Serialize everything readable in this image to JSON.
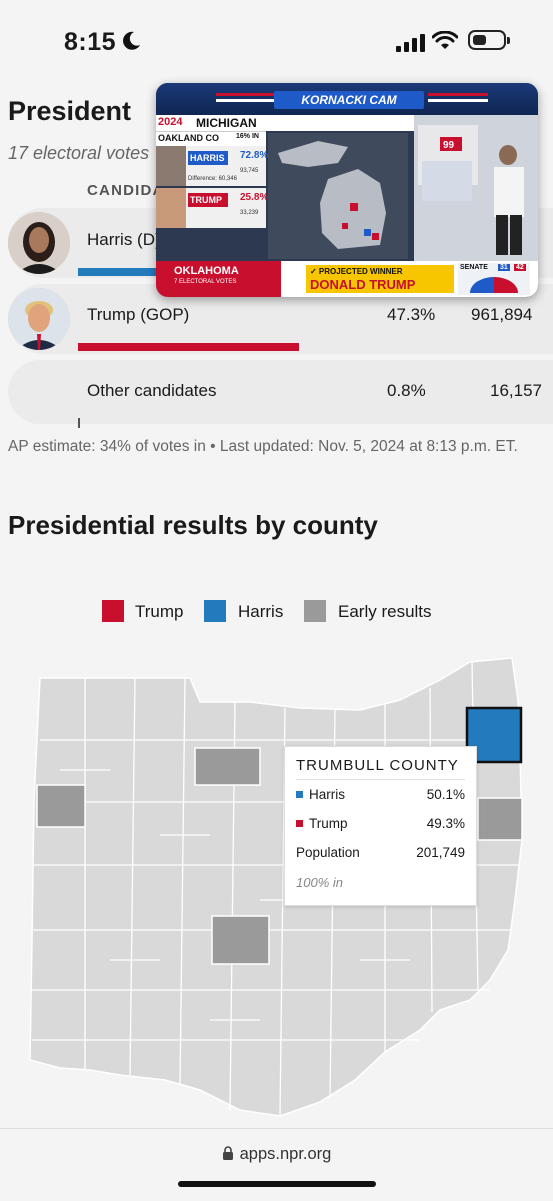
{
  "status_bar": {
    "time": "8:15"
  },
  "race": {
    "title": "President",
    "electoral_votes": "17 electoral votes",
    "candidates_header": "CANDIDATES",
    "candidates": [
      {
        "name": "Harris (D)",
        "pct": "",
        "votes": "",
        "share": 0.519
      },
      {
        "name": "Trump (GOP)",
        "pct": "47.3%",
        "votes": "961,894",
        "share": 0.473
      },
      {
        "name": "Other candidates",
        "pct": "0.8%",
        "votes": "16,157",
        "share": 0.008
      }
    ],
    "footnote": "AP estimate: 34% of votes in • Last updated: Nov. 5, 2024 at 8:13 p.m. ET."
  },
  "county_map": {
    "title": "Presidential results by county",
    "legend": [
      {
        "label": "Trump",
        "color": "#c8102e"
      },
      {
        "label": "Harris",
        "color": "#237bbd"
      },
      {
        "label": "Early results",
        "color": "#9a9a9a"
      }
    ],
    "tooltip": {
      "county": "TRUMBULL COUNTY",
      "rows": [
        {
          "label": "Harris",
          "value": "50.1%",
          "color": "#237bbd"
        },
        {
          "label": "Trump",
          "value": "49.3%",
          "color": "#c8102e"
        },
        {
          "label": "Population",
          "value": "201,749"
        }
      ],
      "reporting": "100% in"
    }
  },
  "pip_video": {
    "banner": "KORNACKI CAM",
    "year": "2024",
    "state": "MICHIGAN",
    "county": "OAKLAND CO",
    "reporting": "16% IN",
    "harris_label": "HARRIS",
    "harris_pct": "72.8%",
    "harris_votes": "93,745",
    "difference_label": "Difference: 60,346",
    "trump_label": "TRUMP",
    "trump_pct": "25.8%",
    "trump_votes": "33,239",
    "ticker_state": "OKLAHOMA",
    "ticker_ev": "7 ELECTORAL VOTES",
    "projected_label": "✓ PROJECTED WINNER",
    "projected_name": "DONALD TRUMP",
    "senate_label": "SENATE",
    "senate_d": "31",
    "senate_r": "42",
    "board_number": "99"
  },
  "browser": {
    "url": "apps.npr.org"
  }
}
